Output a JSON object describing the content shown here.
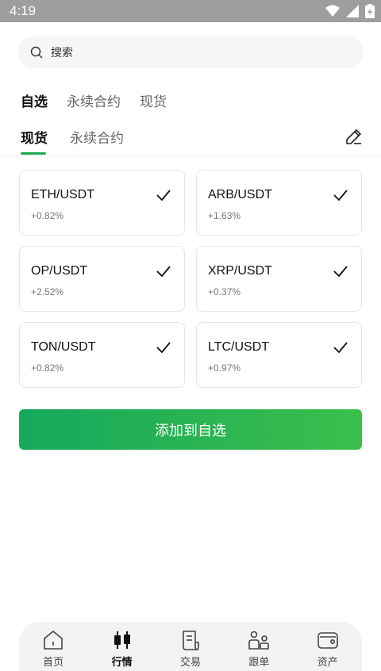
{
  "status_bar": {
    "time": "4:19"
  },
  "search": {
    "placeholder": "搜索"
  },
  "top_tabs": [
    {
      "label": "自选",
      "active": true
    },
    {
      "label": "永续合约",
      "active": false
    },
    {
      "label": "现货",
      "active": false
    }
  ],
  "sub_tabs": [
    {
      "label": "现货",
      "active": true
    },
    {
      "label": "永续合约",
      "active": false
    }
  ],
  "cards": [
    {
      "pair": "ETH/USDT",
      "change": "+0.82%",
      "checked": true
    },
    {
      "pair": "ARB/USDT",
      "change": "+1.63%",
      "checked": true
    },
    {
      "pair": "OP/USDT",
      "change": "+2.52%",
      "checked": true
    },
    {
      "pair": "XRP/USDT",
      "change": "+0.37%",
      "checked": true
    },
    {
      "pair": "TON/USDT",
      "change": "+0.82%",
      "checked": true
    },
    {
      "pair": "LTC/USDT",
      "change": "+0.97%",
      "checked": true
    }
  ],
  "add_button": {
    "label": "添加到自选"
  },
  "bottom_nav": [
    {
      "label": "首页",
      "icon": "home-icon",
      "active": false
    },
    {
      "label": "行情",
      "icon": "candlestick-icon",
      "active": true
    },
    {
      "label": "交易",
      "icon": "document-icon",
      "active": false
    },
    {
      "label": "跟单",
      "icon": "users-icon",
      "active": false
    },
    {
      "label": "资产",
      "icon": "wallet-icon",
      "active": false
    }
  ],
  "colors": {
    "accent": "#1aa851",
    "button_start": "#16a85c",
    "button_end": "#3bbf4a",
    "status_bar": "#9e9e9e"
  }
}
